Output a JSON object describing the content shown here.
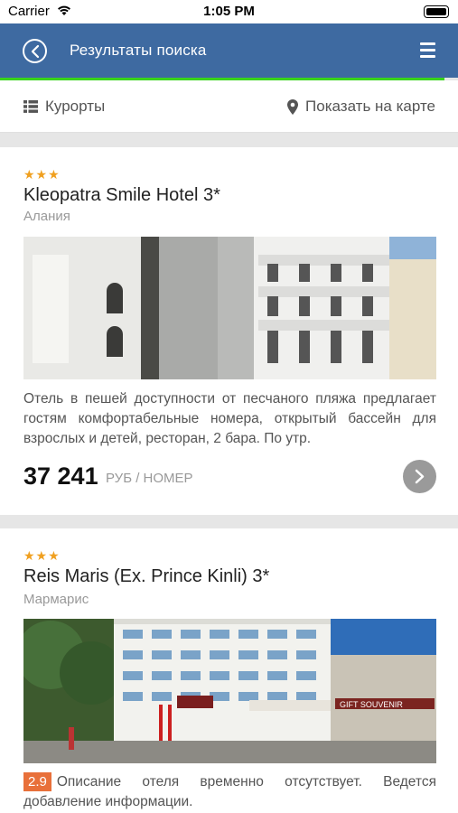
{
  "status_bar": {
    "carrier": "Carrier",
    "time": "1:05 PM"
  },
  "nav": {
    "title": "Результаты поиска",
    "back_icon": "circle-chevron-left-icon",
    "menu_icon": "hamburger-menu-icon"
  },
  "filter_bar": {
    "resorts_label": "Курорты",
    "resorts_icon": "list-icon",
    "map_label": "Показать на карте",
    "map_icon": "map-pin-icon"
  },
  "colors": {
    "nav": "#3e6aa1",
    "progress": "#39d41c",
    "stars": "#f0a020",
    "rating": "#e8703a"
  },
  "hotels": [
    {
      "stars": "★★★",
      "name": "Kleopatra Smile Hotel 3*",
      "city": "Алания",
      "description": "Отель в пешей доступности от песчаного пляжа предлагает гостям комфортабельные номера, открытый бассейн для взрослых и детей, ресторан, 2 бара. По утр.",
      "price": "37 241",
      "unit": "РУБ / НОМЕР"
    },
    {
      "stars": "★★★",
      "name": "Reis Maris (Ex. Prince Kinli) 3*",
      "city": "Мармарис",
      "rating": "2.9",
      "description": "Описание отеля временно отсутствует. Ведется добавление информации.",
      "photo_sign": "GIFT SOUVENIR"
    }
  ]
}
